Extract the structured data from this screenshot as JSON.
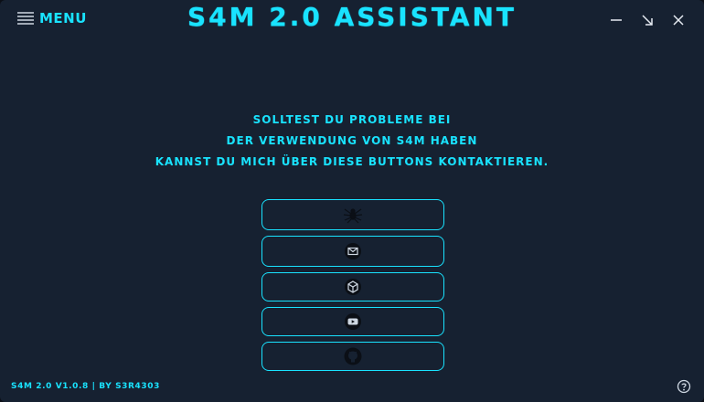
{
  "app": {
    "title": "S4M 2.0 Assistant",
    "accent_color": "#19e3ff",
    "background_color": "#162131"
  },
  "header": {
    "menu_label": "MENU",
    "menu_icon": "hamburger-icon",
    "window_controls": [
      "minimize-icon",
      "restore-icon",
      "close-icon"
    ]
  },
  "message": {
    "line1": "Solltest du Probleme bei",
    "line2": "der Verwendung von S4M haben",
    "line3": "kannst du mich über diese Buttons kontaktieren."
  },
  "contact_buttons": [
    {
      "icon": "spider-icon"
    },
    {
      "icon": "mail-icon"
    },
    {
      "icon": "cube-icon"
    },
    {
      "icon": "youtube-icon"
    },
    {
      "icon": "github-icon"
    }
  ],
  "footer": {
    "text": "S4M 2.0 v1.0.8 | by S3R4303",
    "help_icon": "help-icon"
  }
}
